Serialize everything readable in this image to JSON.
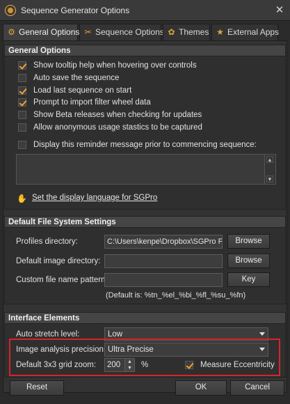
{
  "window": {
    "title": "Sequence Generator Options",
    "close_glyph": "✕"
  },
  "tabs": [
    {
      "label": "General Options",
      "icon": "gear-icon",
      "glyph": "⚙",
      "active": true
    },
    {
      "label": "Sequence Options",
      "icon": "wand-icon",
      "glyph": "✂",
      "active": false
    },
    {
      "label": "Themes",
      "icon": "palette-icon",
      "glyph": "✿",
      "active": false
    },
    {
      "label": "External Apps",
      "icon": "star-app-icon",
      "glyph": "★",
      "active": false
    }
  ],
  "general_options": {
    "header": "General Options",
    "checkboxes": [
      {
        "label": "Show tooltip help when hovering over controls",
        "checked": true
      },
      {
        "label": "Auto save the sequence",
        "checked": false
      },
      {
        "label": "Load last sequence on start",
        "checked": true
      },
      {
        "label": "Prompt to import filter wheel data",
        "checked": true
      },
      {
        "label": "Show Beta releases when checking for updates",
        "checked": false
      },
      {
        "label": "Allow anonymous usage stastics to be captured",
        "checked": false
      },
      {
        "label": "Display this reminder message prior to commencing sequence:",
        "checked": false
      }
    ],
    "reminder_message": "",
    "scroll_up_glyph": "▲",
    "scroll_down_glyph": "▼",
    "language_link": "Set the display language for SGPro",
    "language_icon_glyph": "✋"
  },
  "file_system": {
    "header": "Default File System Settings",
    "profiles_label": "Profiles directory:",
    "profiles_value": "C:\\Users\\kenpe\\Dropbox\\SGPro Pro",
    "image_dir_label": "Default image directory:",
    "image_dir_value": "",
    "pattern_label": "Custom file name pattern:",
    "pattern_value": "",
    "browse_label": "Browse",
    "key_label": "Key",
    "default_hint": "(Default is: %tn_%el_%bi_%fl_%su_%fn)"
  },
  "interface": {
    "header": "Interface Elements",
    "auto_stretch_label": "Auto stretch level:",
    "auto_stretch_value": "Low",
    "precision_label": "Image analysis precision:",
    "precision_value": "Ultra Precise",
    "zoom_label": "Default 3x3 grid zoom:",
    "zoom_value": "200",
    "zoom_unit": "%",
    "spin_up_glyph": "▲",
    "spin_down_glyph": "▼",
    "eccentricity_label": "Measure Eccentricity",
    "eccentricity_checked": true
  },
  "buttons": {
    "reset": "Reset",
    "ok": "OK",
    "cancel": "Cancel"
  }
}
